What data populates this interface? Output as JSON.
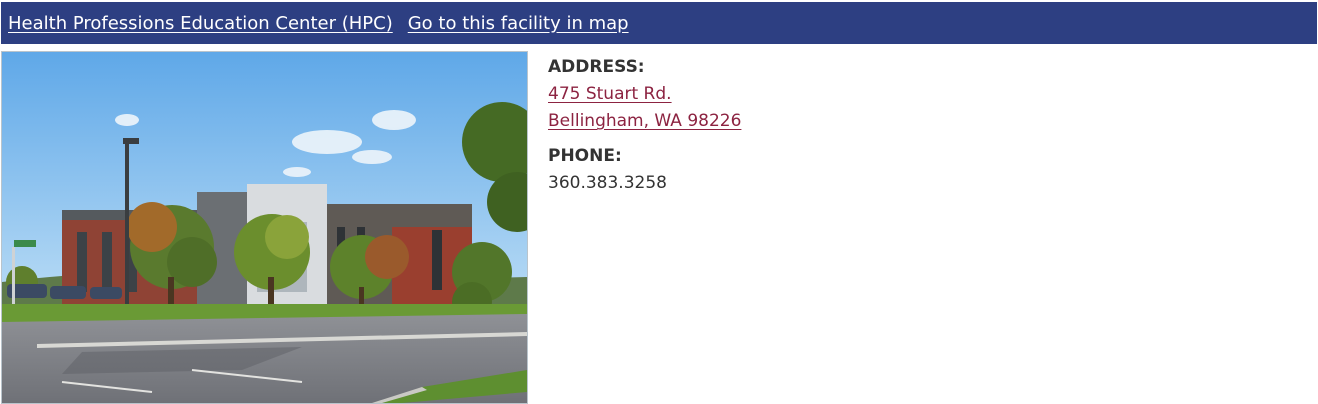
{
  "header": {
    "facility_name": "Health Professions Education Center (HPC)",
    "map_link": "Go to this facility in map",
    "background_color": "#2d3f82"
  },
  "photo": {
    "subject": "building-photo"
  },
  "details": {
    "address_label": "ADDRESS:",
    "address_line1": "475 Stuart Rd.",
    "address_line2": "Bellingham, WA 98226",
    "phone_label": "PHONE:",
    "phone_value": "360.383.3258",
    "link_color": "#8c2341"
  }
}
